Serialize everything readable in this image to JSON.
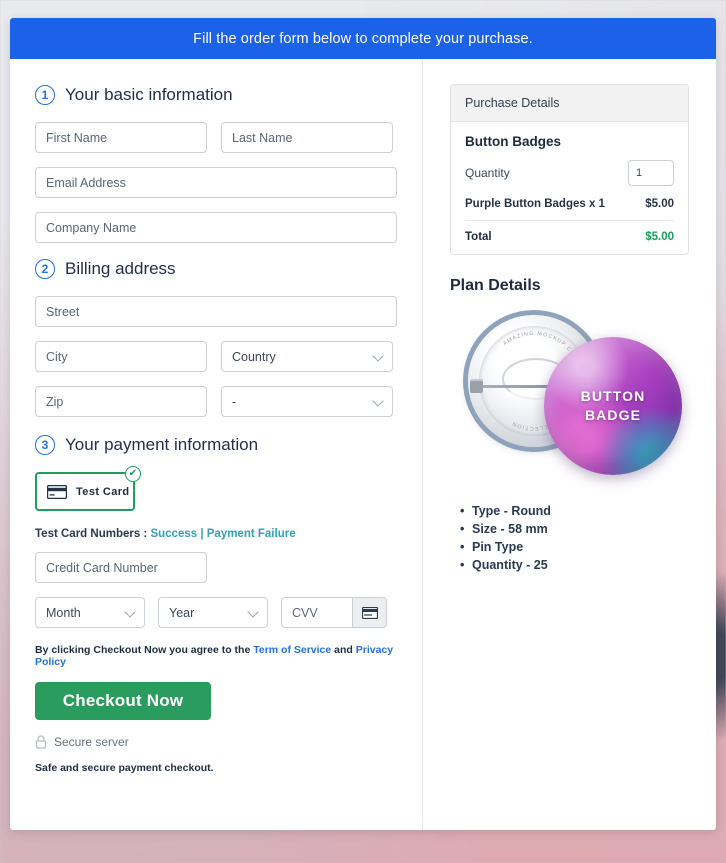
{
  "banner": {
    "message": "Fill the order form below to complete your purchase."
  },
  "form": {
    "section1": {
      "step": "1",
      "title": "Your basic information",
      "first_name_placeholder": "First Name",
      "last_name_placeholder": "Last Name",
      "email_placeholder": "Email Address",
      "company_placeholder": "Company Name"
    },
    "section2": {
      "step": "2",
      "title": "Billing address",
      "street_placeholder": "Street",
      "city_placeholder": "City",
      "country_placeholder": "Country",
      "zip_placeholder": "Zip",
      "state_placeholder": "-"
    },
    "section3": {
      "step": "3",
      "title": "Your payment information",
      "test_card_label": "Test Card",
      "test_card_checked": "✔",
      "test_numbers_prefix": "Test Card Numbers : ",
      "test_numbers_success": "Success",
      "test_numbers_separator": " | ",
      "test_numbers_failure": "Payment Failure",
      "card_number_placeholder": "Credit Card Number",
      "month_placeholder": "Month",
      "year_placeholder": "Year",
      "cvv_placeholder": "CVV"
    },
    "terms": {
      "text_before": "By clicking Checkout Now you agree to the ",
      "terms_link": "Term of Service",
      "text_between": " and ",
      "privacy_link": "Privacy Policy"
    },
    "checkout_button": "Checkout Now",
    "secure_server": "Secure server",
    "safe_note": "Safe and secure payment checkout."
  },
  "purchase": {
    "panel_title": "Purchase Details",
    "product_name": "Button Badges",
    "quantity_label": "Quantity",
    "quantity_value": "1",
    "line_item_label": "Purple Button Badges x 1",
    "line_item_amount": "$5.00",
    "total_label": "Total",
    "total_amount": "$5.00"
  },
  "plan": {
    "title": "Plan Details",
    "badge_front_line1": "BUTTON",
    "badge_front_line2": "BADGE",
    "badge_ring_text_top": "AMAZING MOCKUP",
    "badge_ring_text_left": "AMAZING MOCKUP COLLECTION",
    "badge_ring_text_bottom": "COLLECTION",
    "specs": [
      "Type - Round",
      "Size - 58 mm",
      "Pin Type",
      "Quantity - 25"
    ]
  },
  "colors": {
    "banner_blue": "#1b62e8",
    "step_blue": "#2272e0",
    "checkout_green": "#2a9d5e",
    "total_green": "#18a05a",
    "test_link_teal": "#2fa3b8",
    "terms_link_blue": "#2272e0",
    "card_border_green": "#1e9e5f"
  }
}
